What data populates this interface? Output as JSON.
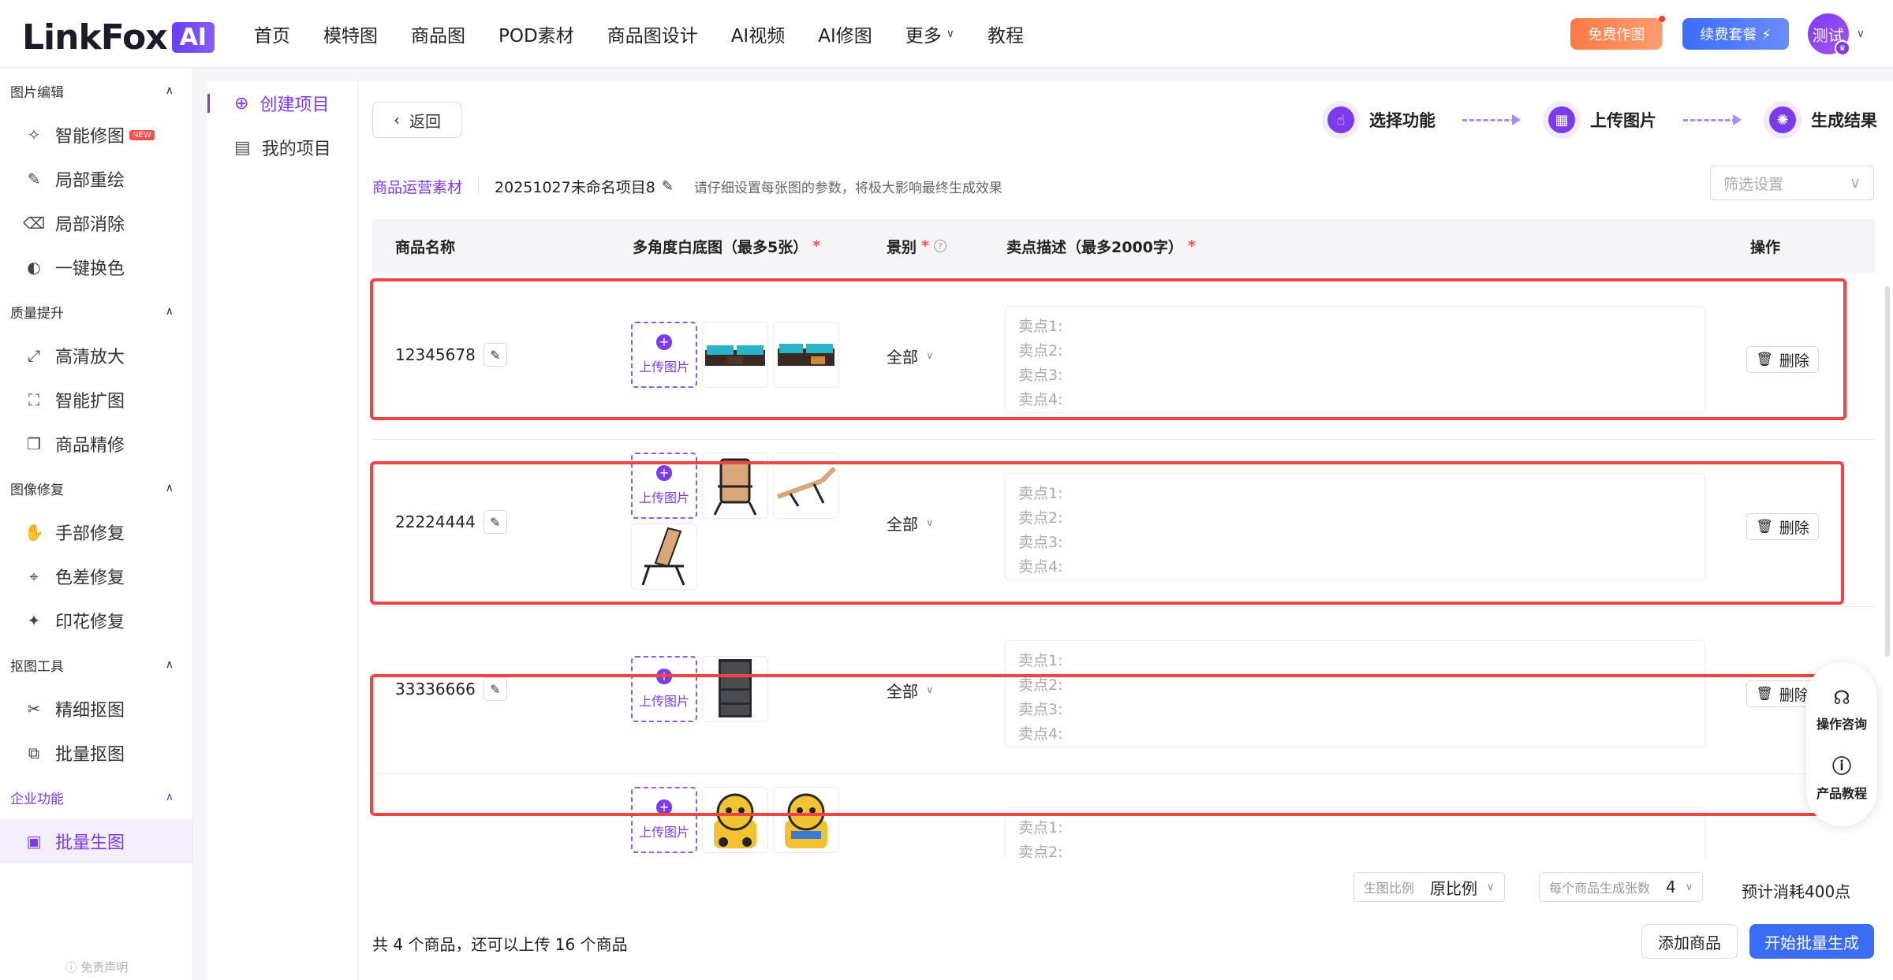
{
  "logo": {
    "text": "LinkFox",
    "badge": "AI"
  },
  "nav": {
    "items": [
      "首页",
      "模特图",
      "商品图",
      "POD素材",
      "商品图设计",
      "AI视频",
      "AI修图",
      "更多",
      "教程"
    ],
    "free_btn": "免费作图",
    "renew_btn": "续费套餐 ⚡",
    "avatar": "测试"
  },
  "sidebar": {
    "groups": [
      {
        "title": "图片编辑",
        "items": [
          "智能修图",
          "局部重绘",
          "局部消除",
          "一键换色"
        ]
      },
      {
        "title": "质量提升",
        "items": [
          "高清放大",
          "智能扩图",
          "商品精修"
        ]
      },
      {
        "title": "图像修复",
        "items": [
          "手部修复",
          "色差修复",
          "印花修复"
        ]
      },
      {
        "title": "抠图工具",
        "items": [
          "精细抠图",
          "批量抠图"
        ]
      },
      {
        "title": "企业功能",
        "items": [
          "批量生图"
        ]
      }
    ],
    "new_badge": "NEW",
    "disclaimer": "ⓘ 免责声明"
  },
  "subnav": {
    "create": "创建项目",
    "mine": "我的项目"
  },
  "main": {
    "back": "返回",
    "steps": [
      "选择功能",
      "上传图片",
      "生成结果"
    ],
    "category": "商品运营素材",
    "project_name": "20251027未命名项目8",
    "hint": "请仔细设置每张图的参数，将极大影响最终生成效果",
    "filter_placeholder": "筛选设置",
    "columns": {
      "name": "商品名称",
      "images": "多角度白底图（最多5张）",
      "scene": "景别",
      "desc": "卖点描述（最多2000字）",
      "ops": "操作"
    },
    "upload_label": "上传图片",
    "scene_value": "全部",
    "desc_placeholders": [
      "卖点1:",
      "卖点2:",
      "卖点3:",
      "卖点4:"
    ],
    "delete_label": "删除",
    "products": [
      {
        "name": "12345678"
      },
      {
        "name": "22224444"
      },
      {
        "name": "33336666"
      },
      {
        "name": ""
      }
    ]
  },
  "float": {
    "consult": "操作咨询",
    "tutorial": "产品教程"
  },
  "bottom": {
    "ratio_label": "生图比例",
    "ratio_value": "原比例",
    "count_label": "每个商品生成张数",
    "count_value": "4",
    "cost": "预计消耗400点",
    "summary": "共 4 个商品，还可以上传 16 个商品",
    "add_btn": "添加商品",
    "start_btn": "开始批量生成"
  },
  "colors": {
    "accent": "#7c3aed",
    "primary_blue": "#3b6cf5",
    "highlight_red": "#ee4444"
  }
}
